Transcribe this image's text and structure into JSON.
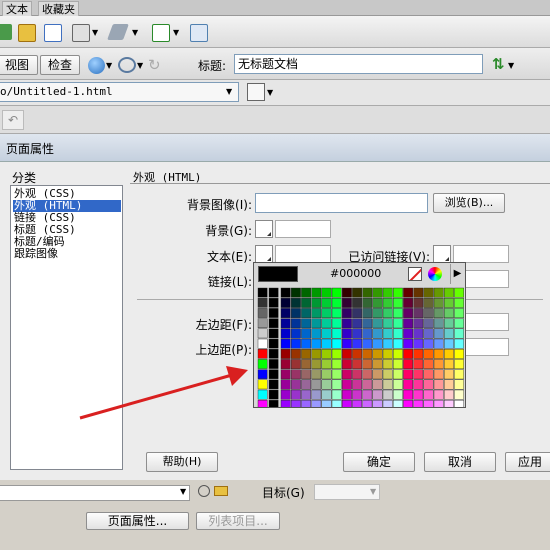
{
  "top_tabs": [
    "文本",
    "收藏夹"
  ],
  "toolbar2": {
    "design_view_label": "视图",
    "check_label": "检查",
    "title_label": "标题:",
    "title_value": "无标题文档"
  },
  "address": {
    "path": "o/Untitled-1.html"
  },
  "dialog": {
    "title": "页面属性",
    "category_header": "分类",
    "categories": [
      "外观 (CSS)",
      "外观 (HTML)",
      "链接 (CSS)",
      "标题 (CSS)",
      "标题/编码",
      "跟踪图像"
    ],
    "selected_category": "外观 (HTML)",
    "section_title": "外观 (HTML)",
    "labels": {
      "bg_image": "背景图像(I):",
      "bg": "背景(G):",
      "text": "文本(E):",
      "visited": "已访问链接(V):",
      "link": "链接(L):",
      "left_margin": "左边距(F):",
      "top_margin": "上边距(P):"
    },
    "browse_label": "浏览(B)...",
    "help_label": "帮助(H)",
    "ok_label": "确定",
    "cancel_label": "取消",
    "apply_label": "应用"
  },
  "picker": {
    "hex_value": "#000000",
    "accent_arrow": "#d92020"
  },
  "bottom": {
    "target_label": "目标(G)",
    "page_props_label": "页面属性...",
    "list_item_label": "列表项目..."
  }
}
